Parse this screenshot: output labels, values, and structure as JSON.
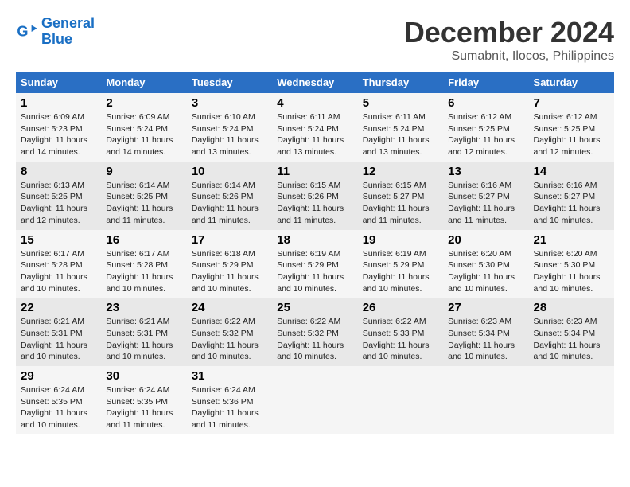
{
  "header": {
    "logo_line1": "General",
    "logo_line2": "Blue",
    "month": "December 2024",
    "location": "Sumabnit, Ilocos, Philippines"
  },
  "weekdays": [
    "Sunday",
    "Monday",
    "Tuesday",
    "Wednesday",
    "Thursday",
    "Friday",
    "Saturday"
  ],
  "weeks": [
    [
      {
        "day": "1",
        "sunrise": "6:09 AM",
        "sunset": "5:23 PM",
        "daylight": "11 hours and 14 minutes."
      },
      {
        "day": "2",
        "sunrise": "6:09 AM",
        "sunset": "5:24 PM",
        "daylight": "11 hours and 14 minutes."
      },
      {
        "day": "3",
        "sunrise": "6:10 AM",
        "sunset": "5:24 PM",
        "daylight": "11 hours and 13 minutes."
      },
      {
        "day": "4",
        "sunrise": "6:11 AM",
        "sunset": "5:24 PM",
        "daylight": "11 hours and 13 minutes."
      },
      {
        "day": "5",
        "sunrise": "6:11 AM",
        "sunset": "5:24 PM",
        "daylight": "11 hours and 13 minutes."
      },
      {
        "day": "6",
        "sunrise": "6:12 AM",
        "sunset": "5:25 PM",
        "daylight": "11 hours and 12 minutes."
      },
      {
        "day": "7",
        "sunrise": "6:12 AM",
        "sunset": "5:25 PM",
        "daylight": "11 hours and 12 minutes."
      }
    ],
    [
      {
        "day": "8",
        "sunrise": "6:13 AM",
        "sunset": "5:25 PM",
        "daylight": "11 hours and 12 minutes."
      },
      {
        "day": "9",
        "sunrise": "6:14 AM",
        "sunset": "5:25 PM",
        "daylight": "11 hours and 11 minutes."
      },
      {
        "day": "10",
        "sunrise": "6:14 AM",
        "sunset": "5:26 PM",
        "daylight": "11 hours and 11 minutes."
      },
      {
        "day": "11",
        "sunrise": "6:15 AM",
        "sunset": "5:26 PM",
        "daylight": "11 hours and 11 minutes."
      },
      {
        "day": "12",
        "sunrise": "6:15 AM",
        "sunset": "5:27 PM",
        "daylight": "11 hours and 11 minutes."
      },
      {
        "day": "13",
        "sunrise": "6:16 AM",
        "sunset": "5:27 PM",
        "daylight": "11 hours and 11 minutes."
      },
      {
        "day": "14",
        "sunrise": "6:16 AM",
        "sunset": "5:27 PM",
        "daylight": "11 hours and 10 minutes."
      }
    ],
    [
      {
        "day": "15",
        "sunrise": "6:17 AM",
        "sunset": "5:28 PM",
        "daylight": "11 hours and 10 minutes."
      },
      {
        "day": "16",
        "sunrise": "6:17 AM",
        "sunset": "5:28 PM",
        "daylight": "11 hours and 10 minutes."
      },
      {
        "day": "17",
        "sunrise": "6:18 AM",
        "sunset": "5:29 PM",
        "daylight": "11 hours and 10 minutes."
      },
      {
        "day": "18",
        "sunrise": "6:19 AM",
        "sunset": "5:29 PM",
        "daylight": "11 hours and 10 minutes."
      },
      {
        "day": "19",
        "sunrise": "6:19 AM",
        "sunset": "5:29 PM",
        "daylight": "11 hours and 10 minutes."
      },
      {
        "day": "20",
        "sunrise": "6:20 AM",
        "sunset": "5:30 PM",
        "daylight": "11 hours and 10 minutes."
      },
      {
        "day": "21",
        "sunrise": "6:20 AM",
        "sunset": "5:30 PM",
        "daylight": "11 hours and 10 minutes."
      }
    ],
    [
      {
        "day": "22",
        "sunrise": "6:21 AM",
        "sunset": "5:31 PM",
        "daylight": "11 hours and 10 minutes."
      },
      {
        "day": "23",
        "sunrise": "6:21 AM",
        "sunset": "5:31 PM",
        "daylight": "11 hours and 10 minutes."
      },
      {
        "day": "24",
        "sunrise": "6:22 AM",
        "sunset": "5:32 PM",
        "daylight": "11 hours and 10 minutes."
      },
      {
        "day": "25",
        "sunrise": "6:22 AM",
        "sunset": "5:32 PM",
        "daylight": "11 hours and 10 minutes."
      },
      {
        "day": "26",
        "sunrise": "6:22 AM",
        "sunset": "5:33 PM",
        "daylight": "11 hours and 10 minutes."
      },
      {
        "day": "27",
        "sunrise": "6:23 AM",
        "sunset": "5:34 PM",
        "daylight": "11 hours and 10 minutes."
      },
      {
        "day": "28",
        "sunrise": "6:23 AM",
        "sunset": "5:34 PM",
        "daylight": "11 hours and 10 minutes."
      }
    ],
    [
      {
        "day": "29",
        "sunrise": "6:24 AM",
        "sunset": "5:35 PM",
        "daylight": "11 hours and 10 minutes."
      },
      {
        "day": "30",
        "sunrise": "6:24 AM",
        "sunset": "5:35 PM",
        "daylight": "11 hours and 11 minutes."
      },
      {
        "day": "31",
        "sunrise": "6:24 AM",
        "sunset": "5:36 PM",
        "daylight": "11 hours and 11 minutes."
      },
      null,
      null,
      null,
      null
    ]
  ]
}
